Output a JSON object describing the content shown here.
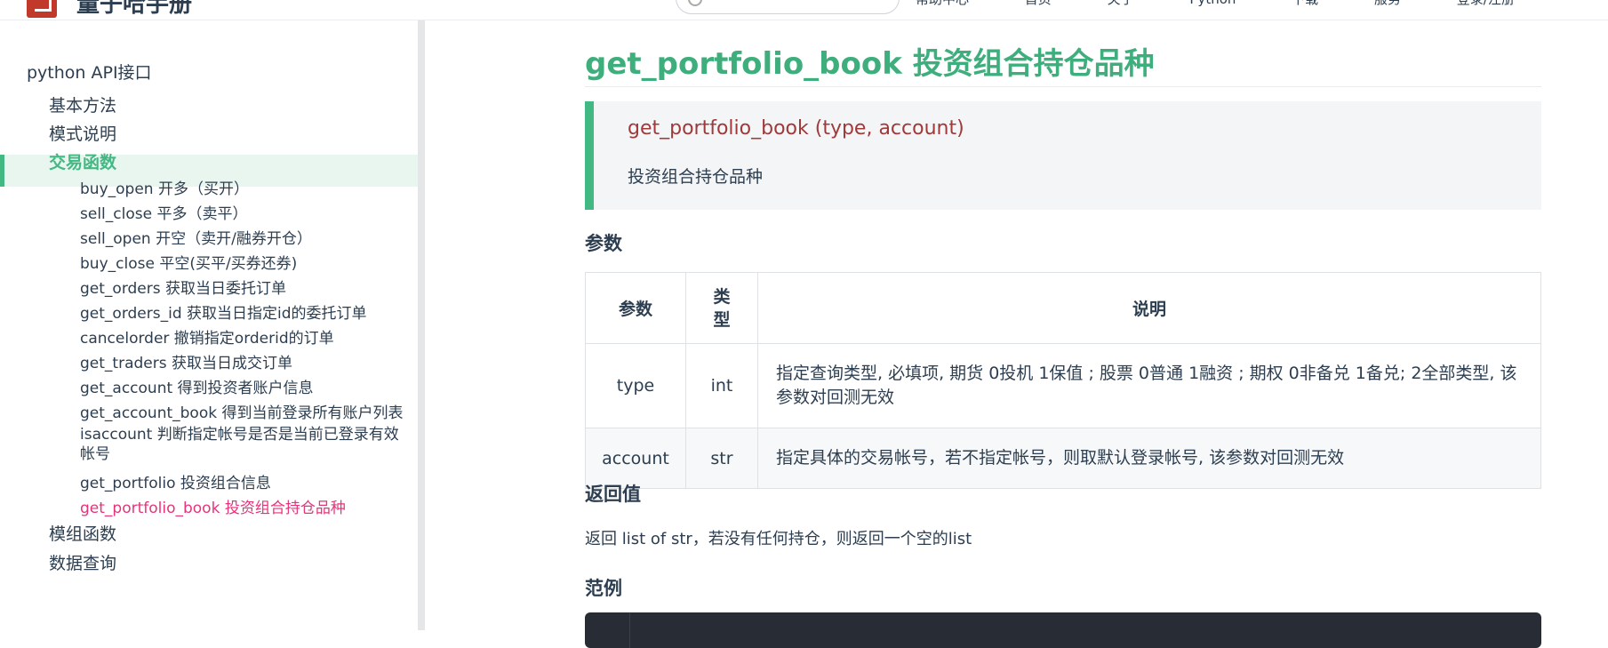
{
  "header": {
    "site_title": "量子哈手册",
    "nav_items": [
      "帮助中心",
      "首页",
      "关于",
      "Python",
      "下载",
      "服务",
      "登录/注册"
    ]
  },
  "sidebar": {
    "group_label": "python API接口",
    "items": [
      {
        "label": "基本方法"
      },
      {
        "label": "模式说明"
      },
      {
        "label": "交易函数",
        "active": true
      },
      {
        "label": "模组函数"
      },
      {
        "label": "数据查询"
      }
    ],
    "sub_items": [
      {
        "label": "buy_open 开多（买开）"
      },
      {
        "label": "sell_close 平多（卖平）"
      },
      {
        "label": "sell_open 开空（卖开/融券开仓）"
      },
      {
        "label": "buy_close 平空(买平/买券还券)"
      },
      {
        "label": "get_orders 获取当日委托订单"
      },
      {
        "label": "get_orders_id 获取当日指定id的委托订单"
      },
      {
        "label": "cancelorder 撤销指定orderid的订单"
      },
      {
        "label": "get_traders 获取当日成交订单"
      },
      {
        "label": "get_account 得到投资者账户信息"
      },
      {
        "label": "get_account_book 得到当前登录所有账户列表"
      },
      {
        "label": "isaccount 判断指定帐号是否是当前已登录有效帐号"
      },
      {
        "label": "get_portfolio 投资组合信息"
      },
      {
        "label": "get_portfolio_book 投资组合持仓品种",
        "current": true
      }
    ]
  },
  "content": {
    "title": "get_portfolio_book 投资组合持仓品种",
    "signature": "get_portfolio_book (type, account)",
    "description": "投资组合持仓品种",
    "params_heading": "参数",
    "table": {
      "headers": [
        "参数",
        "类型",
        "说明"
      ],
      "rows": [
        [
          "type",
          "int",
          "指定查询类型, 必填项, 期货 0投机 1保值 ; 股票 0普通 1融资 ; 期权 0非备兑 1备兑; 2全部类型, 该参数对回测无效"
        ],
        [
          "account",
          "str",
          "指定具体的交易帐号，若不指定帐号，则取默认登录帐号, 该参数对回测无效"
        ]
      ]
    },
    "return_heading": "返回值",
    "return_text": "返回 list of str，若没有任何持仓，则返回一个空的list",
    "example_heading": "范例"
  },
  "colors": {
    "accent": "#42b983",
    "title": "#3eaf7c",
    "current_link": "#e6347a",
    "signature": "#a03a3a",
    "code_bg": "#282c34"
  }
}
